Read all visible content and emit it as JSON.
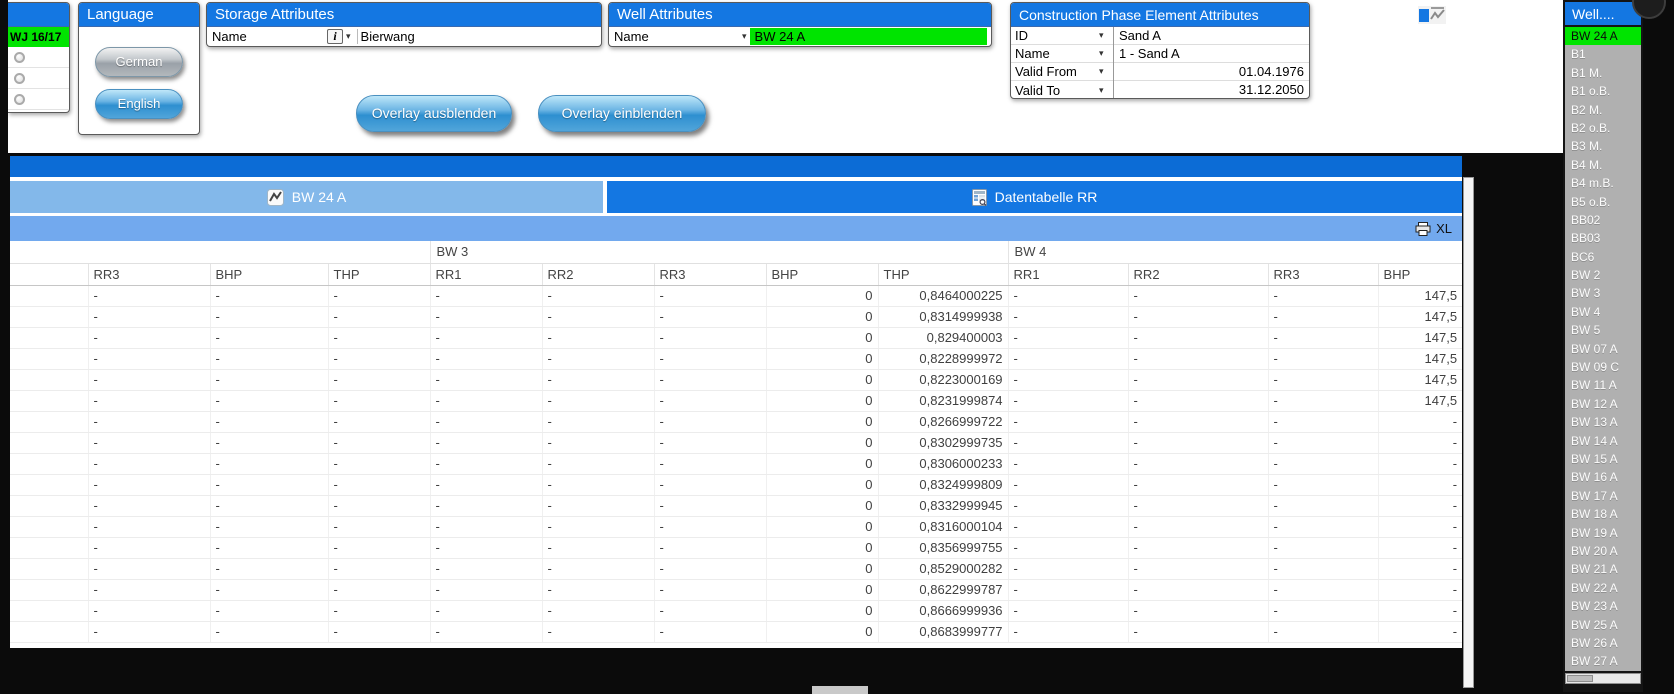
{
  "season_panel": {
    "label": "WJ 16/17",
    "option_count": 3
  },
  "language_panel": {
    "title": "Language",
    "german_label": "German",
    "english_label": "English"
  },
  "storage_panel": {
    "title": "Storage Attributes",
    "name_label": "Name",
    "value": "Bierwang"
  },
  "well_panel": {
    "title": "Well Attributes",
    "name_label": "Name",
    "value": "BW 24 A"
  },
  "construction_panel": {
    "title": "Construction Phase Element Attributes",
    "rows": [
      {
        "label": "ID",
        "value": "Sand A",
        "align": "left"
      },
      {
        "label": "Name",
        "value": "1 - Sand A",
        "align": "left"
      },
      {
        "label": "Valid From",
        "value": "01.04.1976",
        "align": "right"
      },
      {
        "label": "Valid To",
        "value": "31.12.2050",
        "align": "right"
      }
    ]
  },
  "overlay": {
    "hide_label": "Overlay ausblenden",
    "show_label": "Overlay einblenden"
  },
  "tabs": {
    "left_label": "BW 24 A",
    "right_label": "Datentabelle RR"
  },
  "toolbar": {
    "export_label": "XL"
  },
  "data_table": {
    "group_headers": [
      {
        "label": "",
        "span": 4
      },
      {
        "label": "BW 3",
        "span": 5
      },
      {
        "label": "BW 4",
        "span": 4
      }
    ],
    "columns": [
      "",
      "RR3",
      "BHP",
      "THP",
      "RR1",
      "RR2",
      "RR3",
      "BHP",
      "THP",
      "RR1",
      "RR2",
      "RR3",
      "BHP"
    ],
    "rows": [
      [
        "",
        "-",
        "-",
        "-",
        "-",
        "-",
        "-",
        "0",
        "0,8464000225",
        "-",
        "-",
        "-",
        "147,5"
      ],
      [
        "",
        "-",
        "-",
        "-",
        "-",
        "-",
        "-",
        "0",
        "0,8314999938",
        "-",
        "-",
        "-",
        "147,5"
      ],
      [
        "",
        "-",
        "-",
        "-",
        "-",
        "-",
        "-",
        "0",
        "0,829400003",
        "-",
        "-",
        "-",
        "147,5"
      ],
      [
        "",
        "-",
        "-",
        "-",
        "-",
        "-",
        "-",
        "0",
        "0,8228999972",
        "-",
        "-",
        "-",
        "147,5"
      ],
      [
        "",
        "-",
        "-",
        "-",
        "-",
        "-",
        "-",
        "0",
        "0,8223000169",
        "-",
        "-",
        "-",
        "147,5"
      ],
      [
        "",
        "-",
        "-",
        "-",
        "-",
        "-",
        "-",
        "0",
        "0,8231999874",
        "-",
        "-",
        "-",
        "147,5"
      ],
      [
        "",
        "-",
        "-",
        "-",
        "-",
        "-",
        "-",
        "0",
        "0,8266999722",
        "-",
        "-",
        "-",
        "-"
      ],
      [
        "",
        "-",
        "-",
        "-",
        "-",
        "-",
        "-",
        "0",
        "0,8302999735",
        "-",
        "-",
        "-",
        "-"
      ],
      [
        "",
        "-",
        "-",
        "-",
        "-",
        "-",
        "-",
        "0",
        "0,8306000233",
        "-",
        "-",
        "-",
        "-"
      ],
      [
        "",
        "-",
        "-",
        "-",
        "-",
        "-",
        "-",
        "0",
        "0,8324999809",
        "-",
        "-",
        "-",
        "-"
      ],
      [
        "",
        "-",
        "-",
        "-",
        "-",
        "-",
        "-",
        "0",
        "0,8332999945",
        "-",
        "-",
        "-",
        "-"
      ],
      [
        "",
        "-",
        "-",
        "-",
        "-",
        "-",
        "-",
        "0",
        "0,8316000104",
        "-",
        "-",
        "-",
        "-"
      ],
      [
        "",
        "-",
        "-",
        "-",
        "-",
        "-",
        "-",
        "0",
        "0,8356999755",
        "-",
        "-",
        "-",
        "-"
      ],
      [
        "",
        "-",
        "-",
        "-",
        "-",
        "-",
        "-",
        "0",
        "0,8529000282",
        "-",
        "-",
        "-",
        "-"
      ],
      [
        "",
        "-",
        "-",
        "-",
        "-",
        "-",
        "-",
        "0",
        "0,8622999787",
        "-",
        "-",
        "-",
        "-"
      ],
      [
        "",
        "-",
        "-",
        "-",
        "-",
        "-",
        "-",
        "0",
        "0,8666999936",
        "-",
        "-",
        "-",
        "-"
      ],
      [
        "",
        "-",
        "-",
        "-",
        "-",
        "-",
        "-",
        "0",
        "0,8683999777",
        "-",
        "-",
        "-",
        "-"
      ]
    ]
  },
  "well_list": {
    "title": "Well....",
    "selected": "BW 24 A",
    "items": [
      "BW 24 A",
      "B1",
      "B1 M.",
      "B1 o.B.",
      "B2 M.",
      "B2 o.B.",
      "B3 M.",
      "B4 M.",
      "B4 m.B.",
      "B5 o.B.",
      "BB02",
      "BB03",
      "BC6",
      "BW 2",
      "BW 3",
      "BW 4",
      "BW 5",
      "BW 07 A",
      "BW 09 C",
      "BW 11 A",
      "BW 12 A",
      "BW 13 A",
      "BW 14 A",
      "BW 15 A",
      "BW 16 A",
      "BW 17 A",
      "BW 18 A",
      "BW 19 A",
      "BW 20 A",
      "BW 21 A",
      "BW 22 A",
      "BW 23 A",
      "BW 25 A",
      "BW 26 A",
      "BW 27 A"
    ]
  },
  "icons": {
    "info": "i",
    "caret": "▾"
  },
  "colors": {
    "header_blue": "#1477e2",
    "bar_blue": "#0c6cd6",
    "tab_inactive_blue": "#83b8ea",
    "toolbar_blue": "#72a9ee",
    "highlight_green": "#00e400",
    "sidebar_gray": "#b0b0b0"
  }
}
